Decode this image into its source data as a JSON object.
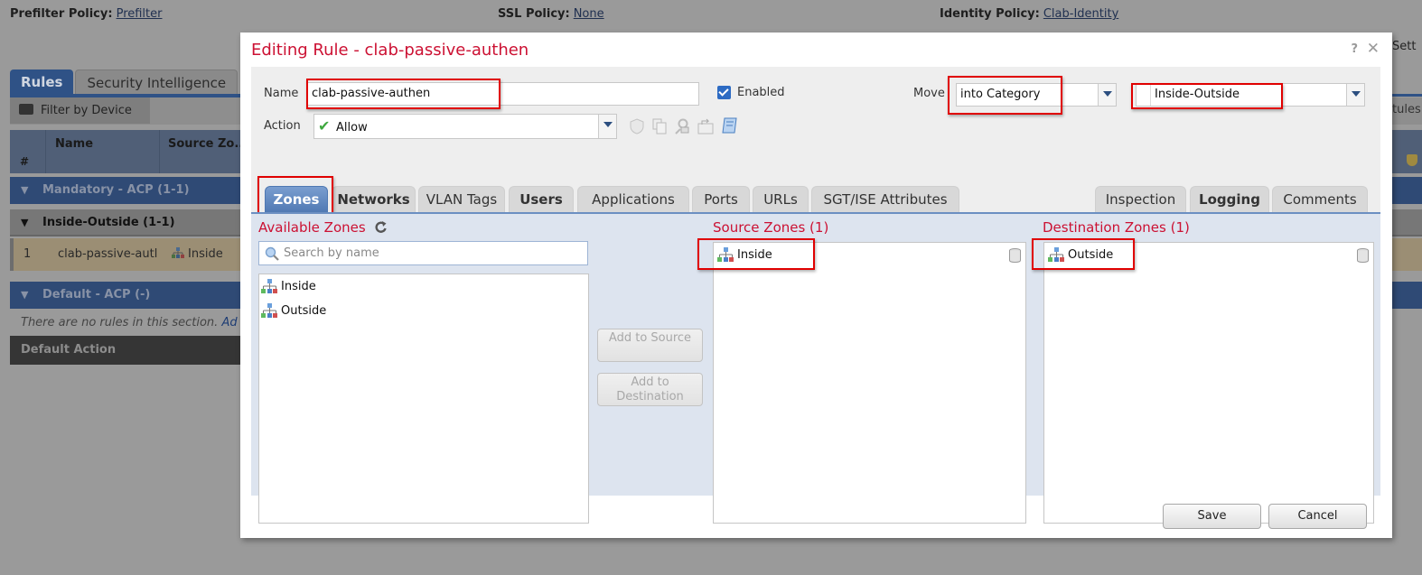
{
  "background": {
    "prefilter_policy": {
      "label": "Prefilter Policy:",
      "value": "Prefilter"
    },
    "ssl_policy": {
      "label": "SSL Policy:",
      "value": "None"
    },
    "identity_policy": {
      "label": "Identity Policy:",
      "value": "Clab-Identity"
    },
    "tabs": [
      "Rules",
      "Security Intelligence"
    ],
    "filter_by_device": "Filter by Device",
    "table_headers": {
      "num": "#",
      "name": "Name",
      "source_zones": "Source Zo..."
    },
    "sections": {
      "mandatory": "Mandatory - ACP (1-1)",
      "inside_outside": "Inside-Outside (1-1)",
      "default": "Default - ACP (-)"
    },
    "row": {
      "num": "1",
      "name": "clab-passive-autl",
      "source_zone": "Inside"
    },
    "no_rules_text": "There are no rules in this section.",
    "no_rules_link": "Ad",
    "default_action": "Default Action",
    "right_partial_top": "Sett",
    "right_partial_rules": "tules"
  },
  "modal": {
    "title": "Editing Rule - clab-passive-authen",
    "help": "?",
    "close": "✕",
    "name_label": "Name",
    "name_value": "clab-passive-authen",
    "enabled_label": "Enabled",
    "enabled_checked": true,
    "move_label": "Move",
    "move_value": "into Category",
    "category_value": "Inside-Outside",
    "action_label": "Action",
    "action_value": "Allow",
    "tabs_left": [
      "Zones",
      "Networks",
      "VLAN Tags",
      "Users",
      "Applications",
      "Ports",
      "URLs",
      "SGT/ISE Attributes"
    ],
    "tabs_right": [
      "Inspection",
      "Logging",
      "Comments"
    ],
    "active_tab": "Zones",
    "available_zones": {
      "title": "Available Zones",
      "search_placeholder": "Search by name",
      "items": [
        "Inside",
        "Outside"
      ]
    },
    "add_to_source": "Add to Source",
    "add_to_destination": "Add to Destination",
    "source_zones": {
      "title": "Source Zones (1)",
      "items": [
        "Inside"
      ]
    },
    "destination_zones": {
      "title": "Destination Zones (1)",
      "items": [
        "Outside"
      ]
    },
    "save": "Save",
    "cancel": "Cancel"
  },
  "colors": {
    "title_red": "#cc1133",
    "highlight_red": "#e00000",
    "tab_active_blue": "#4f78b2",
    "panel_bg": "#dde4ef"
  }
}
